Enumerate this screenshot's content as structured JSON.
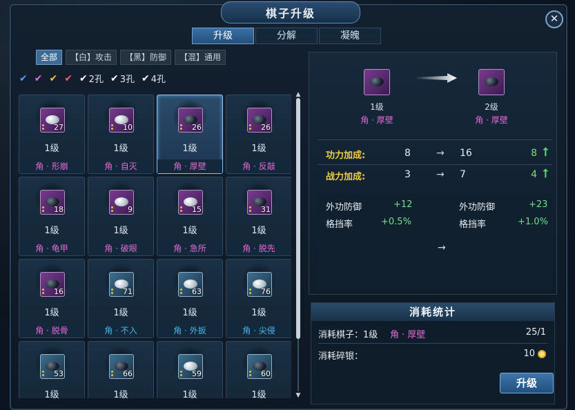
{
  "window": {
    "title": "棋子升级",
    "close_label": "✕"
  },
  "tabs": [
    {
      "label": "升级",
      "active": true
    },
    {
      "label": "分解",
      "active": false
    },
    {
      "label": "凝魄",
      "active": false
    }
  ],
  "filters": [
    {
      "label": "全部",
      "active": true
    },
    {
      "label": "【白】攻击",
      "active": false
    },
    {
      "label": "【黑】防御",
      "active": false
    },
    {
      "label": "【混】通用",
      "active": false
    }
  ],
  "checks": [
    {
      "label": "",
      "color": "#4aa0ff"
    },
    {
      "label": "",
      "color": "#e070e0"
    },
    {
      "label": "",
      "color": "#f0c040"
    },
    {
      "label": "",
      "color": "#f06070"
    },
    {
      "label": "2孔",
      "color": "#ffffff"
    },
    {
      "label": "3孔",
      "color": "#ffffff"
    },
    {
      "label": "4孔",
      "color": "#ffffff"
    }
  ],
  "items": [
    {
      "level": "1级",
      "name": "角 · 形崩",
      "count": "27",
      "stone": "white",
      "color": "purple",
      "selected": false
    },
    {
      "level": "1级",
      "name": "角 · 自灭",
      "count": "10",
      "stone": "white",
      "color": "purple",
      "selected": false
    },
    {
      "level": "1级",
      "name": "角 · 厚壁",
      "count": "26",
      "stone": "black",
      "color": "purple",
      "selected": true
    },
    {
      "level": "1级",
      "name": "角 · 反敲",
      "count": "26",
      "stone": "black",
      "color": "purple",
      "selected": false
    },
    {
      "level": "1级",
      "name": "角 · 龟甲",
      "count": "18",
      "stone": "black",
      "color": "purple",
      "selected": false
    },
    {
      "level": "1级",
      "name": "角 · 破眼",
      "count": "9",
      "stone": "white",
      "color": "purple",
      "selected": false
    },
    {
      "level": "1级",
      "name": "角 · 急所",
      "count": "15",
      "stone": "white",
      "color": "purple",
      "selected": false
    },
    {
      "level": "1级",
      "name": "角 · 脱先",
      "count": "31",
      "stone": "black",
      "color": "purple",
      "selected": false
    },
    {
      "level": "1级",
      "name": "角 · 脱骨",
      "count": "16",
      "stone": "black",
      "color": "purple",
      "selected": false
    },
    {
      "level": "1级",
      "name": "角 · 不入",
      "count": "71",
      "stone": "white",
      "color": "blue",
      "selected": false
    },
    {
      "level": "1级",
      "name": "角 · 外扳",
      "count": "63",
      "stone": "white",
      "color": "blue",
      "selected": false
    },
    {
      "level": "1级",
      "name": "角 · 尖侵",
      "count": "76",
      "stone": "white",
      "color": "blue",
      "selected": false
    },
    {
      "level": "1级",
      "name": "",
      "count": "53",
      "stone": "black",
      "color": "blue",
      "selected": false
    },
    {
      "level": "1级",
      "name": "",
      "count": "66",
      "stone": "black",
      "color": "blue",
      "selected": false
    },
    {
      "level": "1级",
      "name": "",
      "count": "59",
      "stone": "white",
      "color": "blue",
      "selected": false
    },
    {
      "level": "1级",
      "name": "",
      "count": "60",
      "stone": "black",
      "color": "blue",
      "selected": false
    }
  ],
  "preview": {
    "from": {
      "level": "1级",
      "name": "角 · 厚壁"
    },
    "to": {
      "level": "2级",
      "name": "角 · 厚壁"
    }
  },
  "stats": [
    {
      "label": "功力加成:",
      "from": "8",
      "arrow": "→",
      "to": "16",
      "delta": "8",
      "up": "⭡"
    },
    {
      "label": "战力加成:",
      "from": "3",
      "arrow": "→",
      "to": "7",
      "delta": "4",
      "up": "⭡"
    }
  ],
  "attrs": {
    "left": [
      {
        "name": "外功防御",
        "value": "+12"
      },
      {
        "name": "格挡率",
        "value": "+0.5%"
      }
    ],
    "right": [
      {
        "name": "外功防御",
        "value": "+23"
      },
      {
        "name": "格挡率",
        "value": "+1.0%"
      }
    ],
    "arrow": "→"
  },
  "cost": {
    "title": "消耗统计",
    "piece_label": "消耗棋子：1级",
    "piece_name": "角 · 厚壁",
    "piece_value": "25/1",
    "silver_label": "消耗碎银：",
    "silver_value": "10"
  },
  "upgrade_label": "升级",
  "scroll": {
    "up": "▲",
    "down": "▼",
    "visible_fraction": 0.82
  }
}
